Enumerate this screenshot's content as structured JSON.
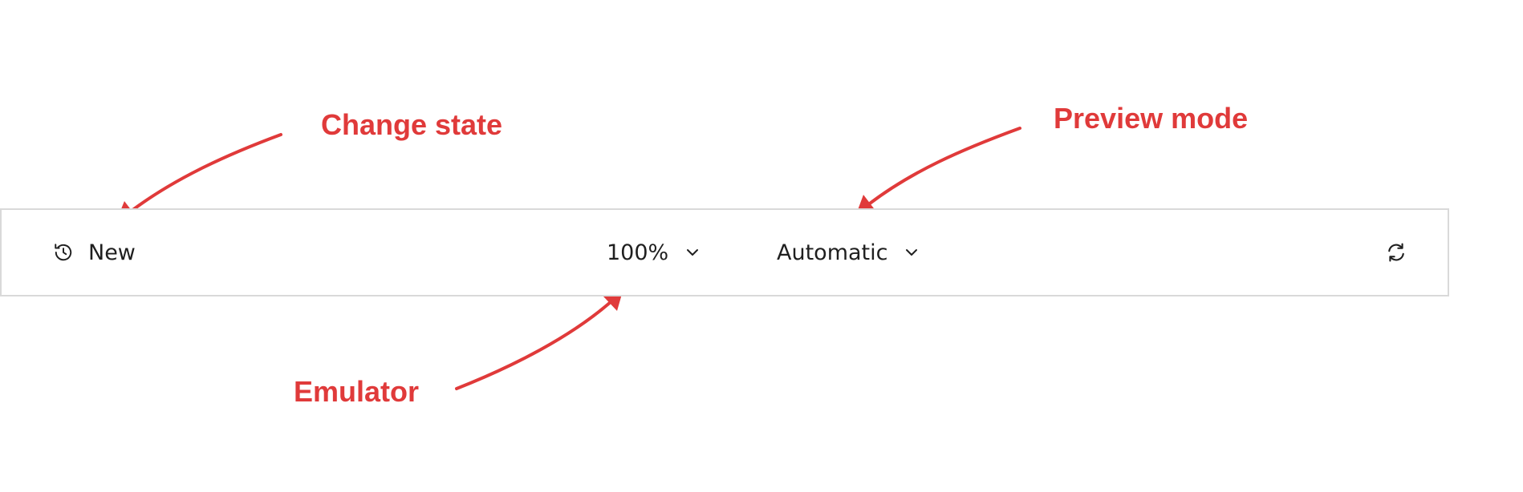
{
  "toolbar": {
    "state_label": "New",
    "zoom_value": "100%",
    "preview_mode": "Automatic"
  },
  "annotations": {
    "change_state": "Change state",
    "preview_mode": "Preview mode",
    "emulator": "Emulator"
  },
  "icons": {
    "state": "history-icon",
    "zoom_dropdown": "chevron-down-icon",
    "mode_dropdown": "chevron-down-icon",
    "refresh": "refresh-icon"
  },
  "colors": {
    "annotation": "#e03a3a",
    "toolbar_border": "#d9d9d9",
    "text": "#1f1f1f"
  }
}
